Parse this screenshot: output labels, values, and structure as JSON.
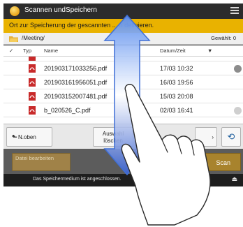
{
  "window": {
    "title": "Scannen undSpeichern",
    "menu_icon": "menu-icon"
  },
  "instruction": "Ort zur Speicherung der gescannten ... n definieren.",
  "path": {
    "folder_icon": "folder-icon",
    "value": "/Meeting/",
    "selected_label": "Gewählt: 0"
  },
  "table": {
    "headers": {
      "check": "✓",
      "type": "Typ",
      "name": "Name",
      "date": "Datum/Zeit",
      "sort": "▼"
    },
    "rows": [
      {
        "name": "201903171033256.pdf",
        "date": "17/03 10:32",
        "selected": true
      },
      {
        "name": "201903161956051.pdf",
        "date": "16/03 19:56",
        "selected": false
      },
      {
        "name": "201903152007481.pdf",
        "date": "15/03 20:08",
        "selected": false
      },
      {
        "name": "b_020526_C.pdf",
        "date": "02/03 16:41",
        "selected": false
      }
    ],
    "file_icon": "pdf-file-icon"
  },
  "buttons": {
    "up": "N.oben",
    "up_icon": "arrow-up-icon",
    "select_all": "Auswahl löschen",
    "more": "...",
    "refresh_icon": "refresh-icon"
  },
  "actions": {
    "edit": "Datei bearbeiten",
    "scan": "Scan"
  },
  "status": {
    "message": "Das Speichermedium ist angeschlossen.",
    "eject_icon": "eject-icon"
  },
  "colors": {
    "accent": "#e9b200",
    "gesture_arrow": "#3f6fd6"
  }
}
